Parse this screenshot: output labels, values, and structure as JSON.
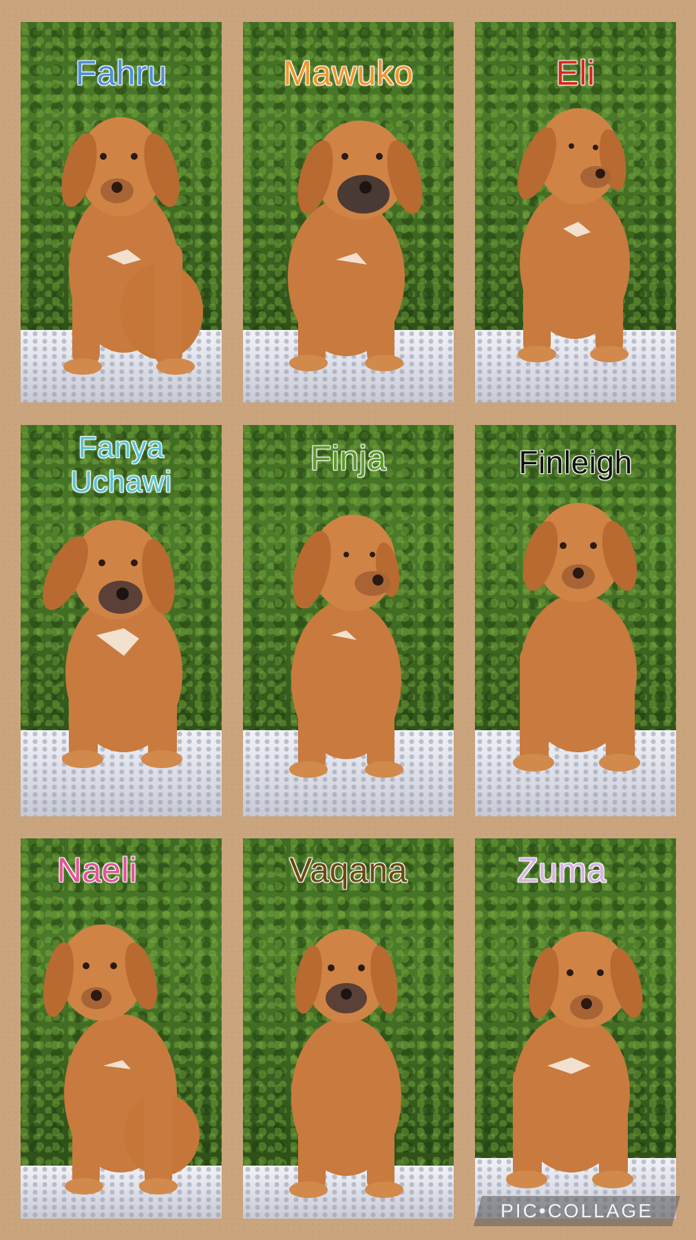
{
  "collage": {
    "puppies": [
      {
        "name": "Fahru",
        "color": "#4f8fd6"
      },
      {
        "name": "Mawuko",
        "color": "#f0962a"
      },
      {
        "name": "Eli",
        "color": "#d8281c"
      },
      {
        "name": "Fanya\nUchawi",
        "color": "#5cc3d3"
      },
      {
        "name": "Finja",
        "color": "#5f9a2d"
      },
      {
        "name": "Finleigh",
        "color": "#111111"
      },
      {
        "name": "Naeli",
        "color": "#e2559a"
      },
      {
        "name": "Vaqana",
        "color": "#6b4a12"
      },
      {
        "name": "Zuma",
        "color": "#d7b3e0"
      }
    ],
    "watermark": "PIC•COLLAGE"
  }
}
